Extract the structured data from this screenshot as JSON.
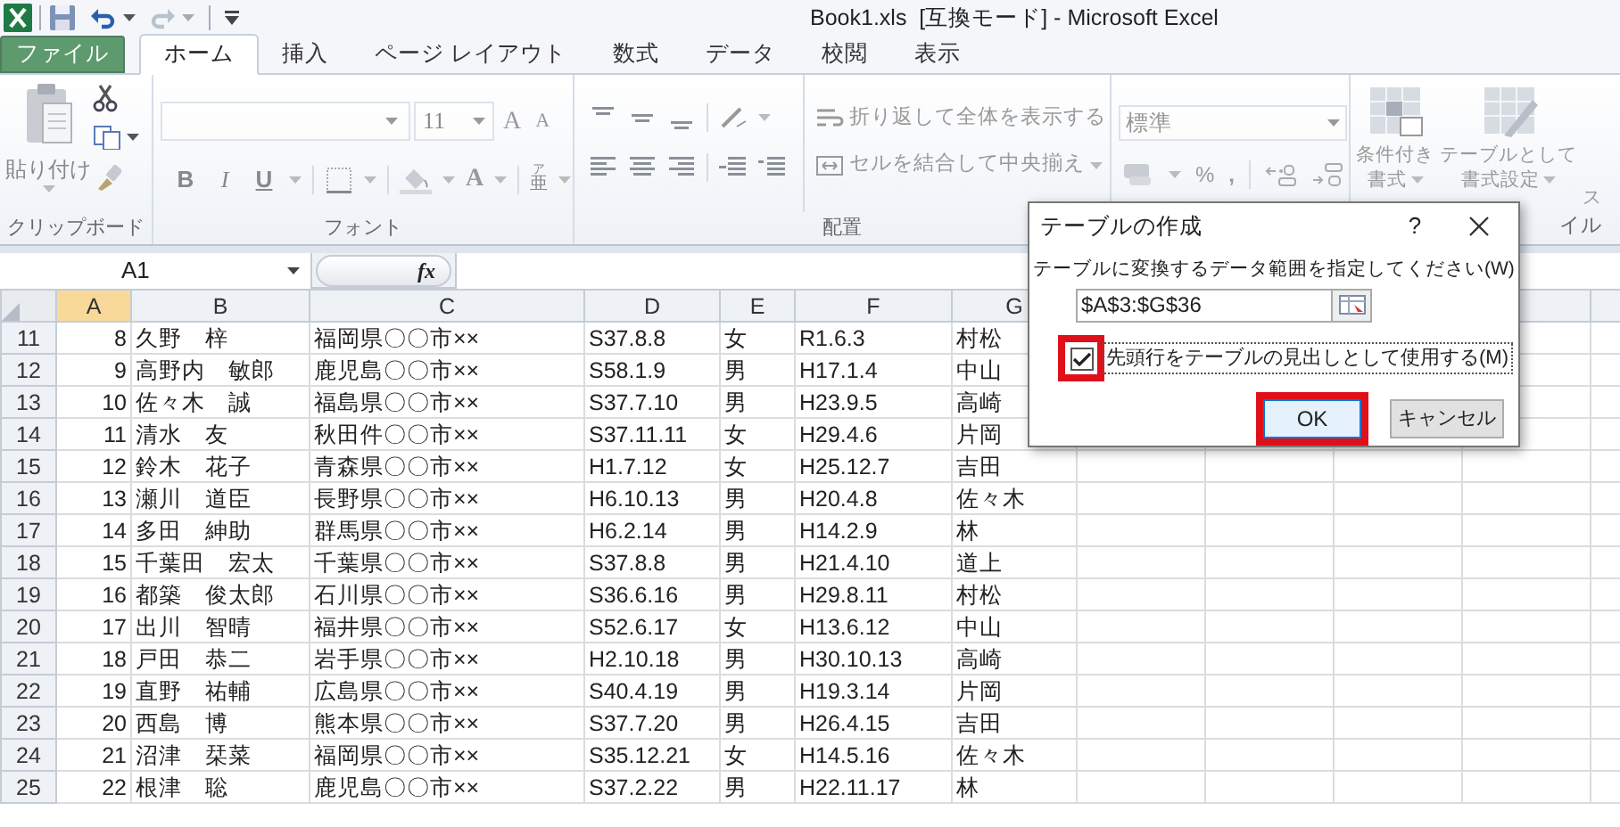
{
  "window": {
    "title": "Book1.xls  [互換モード] - Microsoft Excel"
  },
  "ribbon_tabs": [
    {
      "label": "ファイル",
      "kind": "file",
      "selected": false
    },
    {
      "label": "ホーム",
      "kind": "tab",
      "selected": true
    },
    {
      "label": "挿入",
      "kind": "tab",
      "selected": false
    },
    {
      "label": "ページ レイアウト",
      "kind": "tab",
      "selected": false
    },
    {
      "label": "数式",
      "kind": "tab",
      "selected": false
    },
    {
      "label": "データ",
      "kind": "tab",
      "selected": false
    },
    {
      "label": "校閲",
      "kind": "tab",
      "selected": false
    },
    {
      "label": "表示",
      "kind": "tab",
      "selected": false
    }
  ],
  "ribbon": {
    "clipboard": {
      "paste": "貼り付け",
      "group_label": "クリップボード"
    },
    "font": {
      "size": "11",
      "size_buttons": [
        {
          "kind": "grow",
          "label": "A"
        },
        {
          "kind": "shrink",
          "label": "A"
        }
      ],
      "style_buttons": [
        {
          "kind": "bold",
          "label": "B"
        },
        {
          "kind": "italic",
          "label": "I"
        },
        {
          "kind": "underline",
          "label": "U"
        }
      ],
      "font_color": "A",
      "phonetic": {
        "ruby": "ア",
        "base": "亜"
      },
      "group_label": "フォント"
    },
    "alignment": {
      "wrap": "折り返して全体を表示する",
      "merge": "セルを結合して中央揃え",
      "group_label": "配置"
    },
    "number": {
      "format": "標準",
      "percent": "%",
      "comma": ","
    },
    "styles": {
      "conditional": [
        "条件付き",
        "書式"
      ],
      "table": [
        "テーブルとして",
        "書式設定"
      ],
      "third": "ス",
      "group_label": "イル"
    }
  },
  "formula_bar": {
    "name_box": "A1",
    "fx": "fx"
  },
  "sheet": {
    "columns": [
      {
        "label": "A",
        "selected": true
      },
      {
        "label": "B",
        "selected": false
      },
      {
        "label": "C",
        "selected": false
      },
      {
        "label": "D",
        "selected": false
      },
      {
        "label": "E",
        "selected": false
      },
      {
        "label": "F",
        "selected": false
      },
      {
        "label": "G",
        "selected": false
      }
    ],
    "rows": [
      {
        "number": "11",
        "cells": [
          "8",
          "久野　梓",
          "福岡県〇〇市××",
          "S37.8.8",
          "女",
          "R1.6.3",
          "村松"
        ]
      },
      {
        "number": "12",
        "cells": [
          "9",
          "高野内　敏郎",
          "鹿児島〇〇市××",
          "S58.1.9",
          "男",
          "H17.1.4",
          "中山"
        ]
      },
      {
        "number": "13",
        "cells": [
          "10",
          "佐々木　誠",
          "福島県〇〇市××",
          "S37.7.10",
          "男",
          "H23.9.5",
          "高崎"
        ]
      },
      {
        "number": "14",
        "cells": [
          "11",
          "清水　友",
          "秋田件〇〇市××",
          "S37.11.11",
          "女",
          "H29.4.6",
          "片岡"
        ]
      },
      {
        "number": "15",
        "cells": [
          "12",
          "鈴木　花子",
          "青森県〇〇市××",
          "H1.7.12",
          "女",
          "H25.12.7",
          "吉田"
        ]
      },
      {
        "number": "16",
        "cells": [
          "13",
          "瀬川　道臣",
          "長野県〇〇市××",
          "H6.10.13",
          "男",
          "H20.4.8",
          "佐々木"
        ]
      },
      {
        "number": "17",
        "cells": [
          "14",
          "多田　紳助",
          "群馬県〇〇市××",
          "H6.2.14",
          "男",
          "H14.2.9",
          "林"
        ]
      },
      {
        "number": "18",
        "cells": [
          "15",
          "千葉田　宏太",
          "千葉県〇〇市××",
          "S37.8.8",
          "男",
          "H21.4.10",
          "道上"
        ]
      },
      {
        "number": "19",
        "cells": [
          "16",
          "都築　俊太郎",
          "石川県〇〇市××",
          "S36.6.16",
          "男",
          "H29.8.11",
          "村松"
        ]
      },
      {
        "number": "20",
        "cells": [
          "17",
          "出川　智晴",
          "福井県〇〇市××",
          "S52.6.17",
          "女",
          "H13.6.12",
          "中山"
        ]
      },
      {
        "number": "21",
        "cells": [
          "18",
          "戸田　恭二",
          "岩手県〇〇市××",
          "H2.10.18",
          "男",
          "H30.10.13",
          "高崎"
        ]
      },
      {
        "number": "22",
        "cells": [
          "19",
          "直野　祐輔",
          "広島県〇〇市××",
          "S40.4.19",
          "男",
          "H19.3.14",
          "片岡"
        ]
      },
      {
        "number": "23",
        "cells": [
          "20",
          "西島　博",
          "熊本県〇〇市××",
          "S37.7.20",
          "男",
          "H26.4.15",
          "吉田"
        ]
      },
      {
        "number": "24",
        "cells": [
          "21",
          "沼津　栞菜",
          "福岡県〇〇市××",
          "S35.12.21",
          "女",
          "H14.5.16",
          "佐々木"
        ]
      },
      {
        "number": "25",
        "cells": [
          "22",
          "根津　聡",
          "鹿児島〇〇市××",
          "S37.2.22",
          "男",
          "H22.11.17",
          "林"
        ]
      }
    ]
  },
  "dialog": {
    "title": "テーブルの作成",
    "help": "?",
    "prompt": "テーブルに変換するデータ範囲を指定してください(W)",
    "range": "$A$3:$G$36",
    "checkbox": {
      "label": "先頭行をテーブルの見出しとして使用する(M)",
      "checked": true,
      "highlighted": true
    },
    "ok": {
      "label": "OK",
      "highlighted": true
    },
    "cancel": "キャンセル"
  }
}
